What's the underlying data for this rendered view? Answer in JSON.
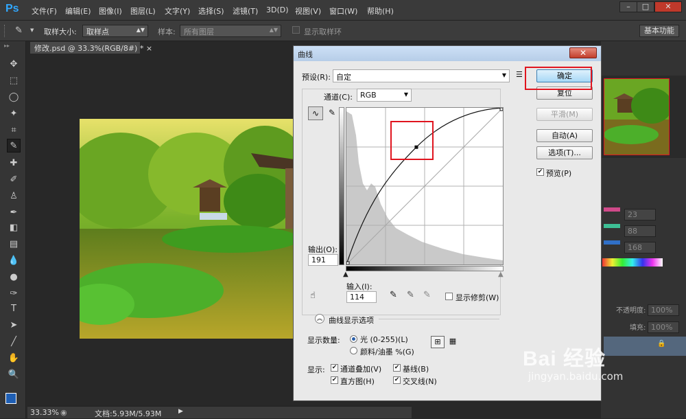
{
  "app": {
    "logo": "Ps"
  },
  "menu": [
    "文件(F)",
    "编辑(E)",
    "图像(I)",
    "图层(L)",
    "文字(Y)",
    "选择(S)",
    "滤镜(T)",
    "3D(D)",
    "视图(V)",
    "窗口(W)",
    "帮助(H)"
  ],
  "options": {
    "sample_size_label": "取样大小:",
    "sample_size_value": "取样点",
    "sample_label": "样本:",
    "sample_value": "所有图层",
    "show_ring_label": "显示取样环",
    "workspace": "基本功能"
  },
  "document": {
    "tab_title": "修改.psd @ 33.3%(RGB/8#) *"
  },
  "status": {
    "zoom": "33.33%",
    "doc_size": "文档:5.93M/5.93M"
  },
  "right_panel": {
    "rgb_values": [
      "23",
      "88",
      "168"
    ],
    "opacity_label": "不透明度:",
    "opacity_value": "100%",
    "fill_label": "填充:",
    "fill_value": "100%"
  },
  "curves_dialog": {
    "title": "曲线",
    "preset_label": "预设(R):",
    "preset_value": "自定",
    "channel_label": "通道(C):",
    "channel_value": "RGB",
    "output_label": "输出(O):",
    "output_value": "191",
    "input_label": "输入(I):",
    "input_value": "114",
    "show_clipping_label": "显示修剪(W)",
    "curve_options_label": "曲线显示选项",
    "show_amount_label": "显示数量:",
    "light_option": "光 (0-255)(L)",
    "pigment_option": "颜料/油墨 %(G)",
    "show_label": "显示:",
    "channel_overlays": "通道叠加(V)",
    "baseline": "基线(B)",
    "histogram": "直方图(H)",
    "intersection": "交叉线(N)",
    "buttons": {
      "ok": "确定",
      "reset": "复位",
      "smooth": "平滑(M)",
      "auto": "自动(A)",
      "options": "选项(T)..."
    },
    "preview_label": "预览(P)",
    "curve_points": [
      [
        0,
        0
      ],
      [
        114,
        191
      ],
      [
        255,
        255
      ]
    ]
  },
  "watermark": {
    "brand": "Bai 经验",
    "url": "jingyan.baidu.com"
  },
  "colors": {
    "accent": "#31a8ff",
    "highlight_box": "#e0141e",
    "foreground_swatch": "#1f5fb4"
  }
}
